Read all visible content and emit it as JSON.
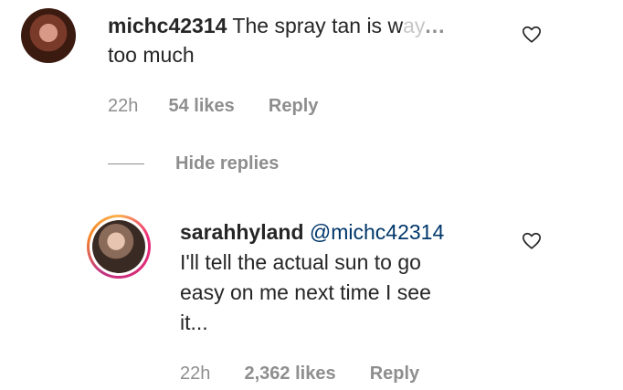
{
  "comments": [
    {
      "username": "michc42314",
      "text_line1": "The spray tan is w",
      "text_faded": "ay",
      "more_label": "...",
      "text_line2": "too much",
      "time": "22h",
      "likes": "54 likes",
      "reply_label": "Reply"
    }
  ],
  "hide_replies_label": "Hide replies",
  "replies": [
    {
      "username": "sarahhyland",
      "mention": "@michc42314",
      "text_line1": "I'll tell the actual sun to go",
      "text_line2": "easy on me next time I see",
      "text_line3": "it...",
      "time": "22h",
      "likes": "2,362 likes",
      "reply_label": "Reply"
    }
  ],
  "icons": {
    "avatar_1": "user-avatar",
    "avatar_2": "user-avatar-story-ring",
    "heart": "heart-outline-icon"
  },
  "colors": {
    "text": "#262626",
    "meta": "#8e8e8e",
    "mention": "#00376b",
    "story_ring_start": "#f9b24e",
    "story_ring_end": "#c13584"
  }
}
